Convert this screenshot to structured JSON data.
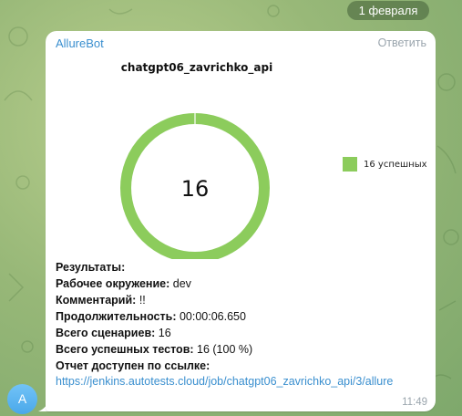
{
  "date_separator": "1 февраля",
  "message": {
    "sender": "AllureBot",
    "reply_label": "Ответить",
    "time": "11:49",
    "avatar_letter": "A",
    "lines": {
      "results": "Результаты:",
      "env_label": "Рабочее окружение:",
      "env_value": " dev",
      "comment_label": "Комментарий:",
      "comment_value": " !!",
      "duration_label": "Продолжительность:",
      "duration_value": " 00:00:06.650",
      "scenarios_label": "Всего сценариев:",
      "scenarios_value": " 16",
      "passed_label": "Всего успешных тестов:",
      "passed_value": " 16 (100 %)",
      "report_label": "Отчет доступен по ссылке:",
      "report_link": "https://jenkins.autotests.cloud/job/chatgpt06_zavrichko_api/3/allure"
    }
  },
  "chart_data": {
    "type": "pie",
    "title": "chatgpt06_zavrichko_api",
    "center_label": "16",
    "labels": [
      "16 успешных"
    ],
    "values": [
      16
    ],
    "colors": [
      "#8ccc5c"
    ],
    "legend_position": "right"
  },
  "colors": {
    "accent": "#3a8fcf",
    "passed": "#8ccc5c",
    "bubble": "#ffffff",
    "meta_text": "#9aa5ad"
  }
}
